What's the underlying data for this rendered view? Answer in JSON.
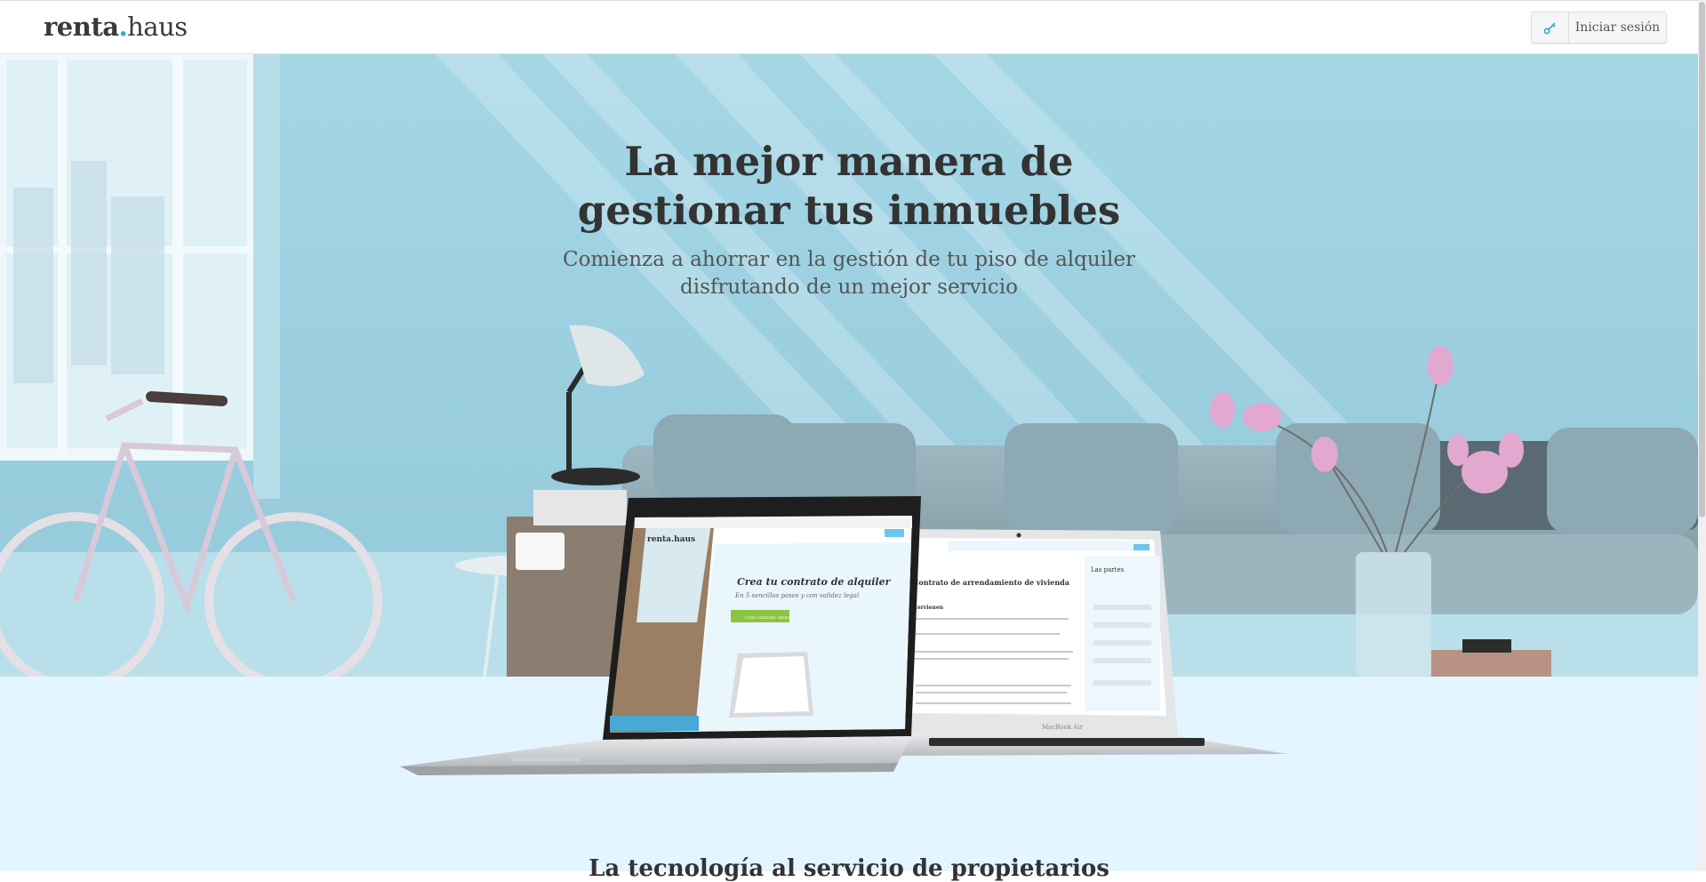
{
  "header": {
    "logo": {
      "part1": "renta",
      "dot": ".",
      "part2": "haus"
    },
    "login_label": "Iniciar sesión"
  },
  "hero": {
    "title_line1": "La mejor manera de",
    "title_line2": "gestionar tus inmuebles",
    "subtitle_line1": "Comienza a ahorrar en la gestión de tu piso de alquiler",
    "subtitle_line2": "disfrutando de un mejor servicio"
  },
  "laptop_left": {
    "brand": "renta.haus",
    "heading": "Crea tu contrato de alquiler",
    "subheading": "En 5 sencillos pasos y con validez legal",
    "cta": "Crea contrato ahora"
  },
  "laptop_right": {
    "doc_title": "Contrato de arrendamiento de vivienda",
    "section1": "Intervienen",
    "sidebar_title": "Las partes",
    "footer_label": "MacBook Air"
  },
  "section": {
    "title": "La tecnología al servicio de propietarios"
  },
  "colors": {
    "accent": "#2ea8d8",
    "hero_bg": "#a6d9e8",
    "section_bg": "#e3f5fe",
    "cta_green": "#8cc43f"
  }
}
